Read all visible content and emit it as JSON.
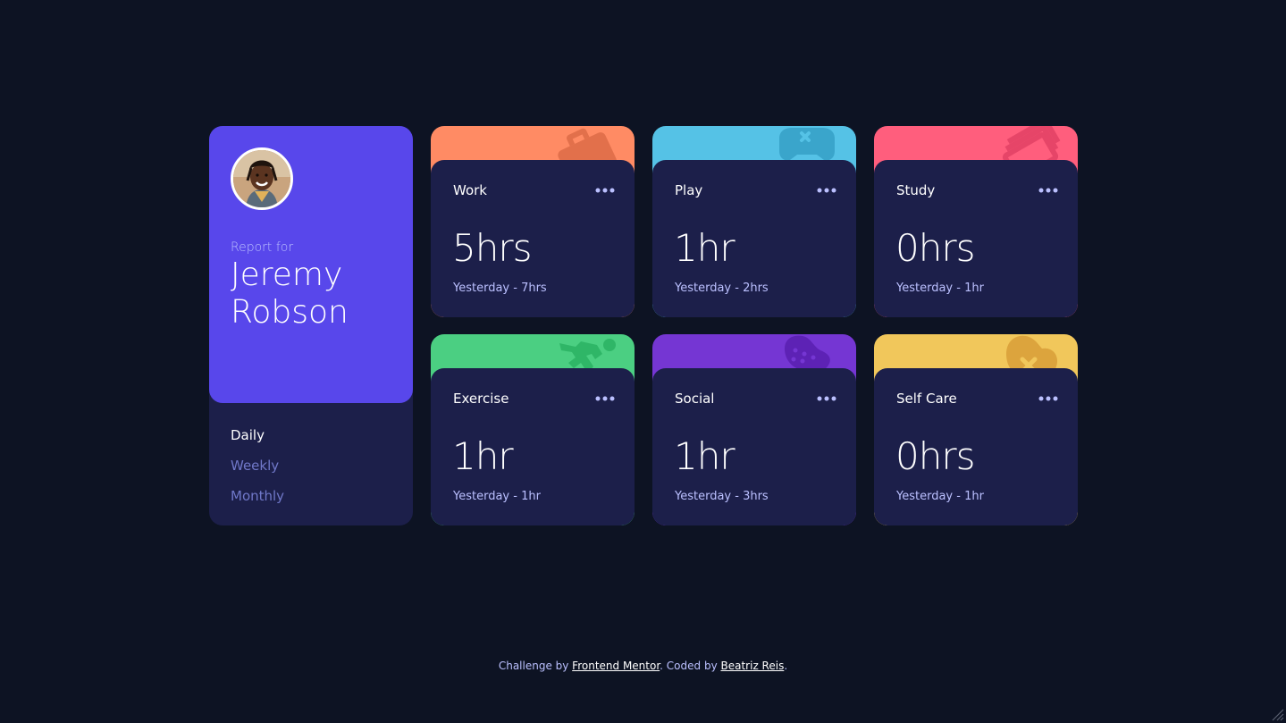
{
  "profile": {
    "report_for": "Report for",
    "name": "Jeremy Robson",
    "avatar_icon": "user-avatar-photo"
  },
  "periods": [
    {
      "label": "Daily",
      "active": true
    },
    {
      "label": "Weekly",
      "active": false
    },
    {
      "label": "Monthly",
      "active": false
    }
  ],
  "cards": [
    {
      "title": "Work",
      "current": "5hrs",
      "previous": "Yesterday - 7hrs",
      "color": "#ff8b64",
      "icon": "briefcase-icon"
    },
    {
      "title": "Play",
      "current": "1hr",
      "previous": "Yesterday - 2hrs",
      "color": "#55c2e6",
      "icon": "gamepad-icon"
    },
    {
      "title": "Study",
      "current": "0hrs",
      "previous": "Yesterday - 1hr",
      "color": "#ff5e7d",
      "icon": "books-icon"
    },
    {
      "title": "Exercise",
      "current": "1hr",
      "previous": "Yesterday - 1hr",
      "color": "#4bcf82",
      "icon": "running-icon"
    },
    {
      "title": "Social",
      "current": "1hr",
      "previous": "Yesterday - 3hrs",
      "color": "#7536d3",
      "icon": "chat-bubble-icon"
    },
    {
      "title": "Self Care",
      "current": "0hrs",
      "previous": "Yesterday - 1hr",
      "color": "#f1c75b",
      "icon": "heart-care-icon"
    }
  ],
  "footer": {
    "prefix": "Challenge by ",
    "link1": "Frontend Mentor",
    "middle": ". Coded by ",
    "link2": "Beatriz Reis",
    "suffix": "."
  },
  "colors": {
    "background": "#0d1323",
    "card": "#1c1f4a",
    "profile_accent": "#5847eb",
    "muted": "#bbc0ff",
    "inactive_period": "#7078c9"
  }
}
